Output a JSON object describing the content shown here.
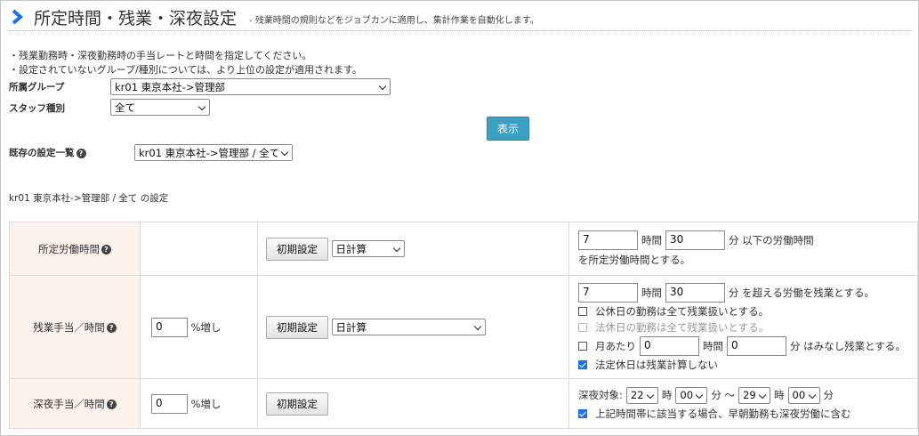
{
  "header": {
    "title": "所定時間・残業・深夜設定",
    "subtitle": "- 残業時間の規則などをジョブカンに適用し、集計作業を自動化します。",
    "accent_color": "#1a73e8"
  },
  "notes": [
    "・残業勤務時・深夜勤務時の手当レートと時間を指定してください。",
    "・設定されていないグループ/種別については、より上位の設定が適用されます。"
  ],
  "filters": {
    "group_label": "所属グループ",
    "group_value": "kr01 東京本社->管理部",
    "staff_label": "スタッフ種別",
    "staff_value": "全て",
    "show_button": "表示",
    "existing_label": "既存の設定一覧",
    "existing_value": "kr01 東京本社->管理部 / 全て"
  },
  "settings_title": "kr01 東京本社->管理部 / 全て の設定",
  "rows": {
    "scheduled": {
      "label": "所定労働時間",
      "init_button": "初期設定",
      "calc_select": "日計算",
      "hours": "7",
      "hours_unit": "時間",
      "minutes": "30",
      "minutes_suffix": "分 以下の労働時間",
      "line2": "を所定労働時間とする。"
    },
    "overtime": {
      "label": "残業手当／時間",
      "pct": "0",
      "pct_suffix": "%増し",
      "init_button": "初期設定",
      "calc_select": "日計算",
      "hours": "7",
      "hours_unit": "時間",
      "minutes": "30",
      "minutes_suffix": "分 を超える労働を残業とする。",
      "cb_public_holiday": "公休日の勤務は全て残業扱いとする。",
      "cb_legal_holiday": "法休日の勤務は全て残業扱いとする。",
      "cb_monthly_prefix": "月あたり",
      "monthly_hours": "0",
      "monthly_hours_unit": "時間",
      "monthly_minutes": "0",
      "monthly_suffix": "分 はみなし残業とする。",
      "cb_legal_no_calc": "法定休日は残業計算しない"
    },
    "night": {
      "label": "深夜手当／時間",
      "pct": "0",
      "pct_suffix": "%増し",
      "init_button": "初期設定",
      "target_label": "深夜対象:",
      "start_hour": "22",
      "hour_unit": "時",
      "start_min": "00",
      "min_unit_tilde": "分 〜",
      "end_hour": "29",
      "end_min": "00",
      "min_unit": "分",
      "cb_early": "上記時間帯に該当する場合、早朝勤務も深夜労働に含む"
    }
  },
  "help_glyph": "?"
}
